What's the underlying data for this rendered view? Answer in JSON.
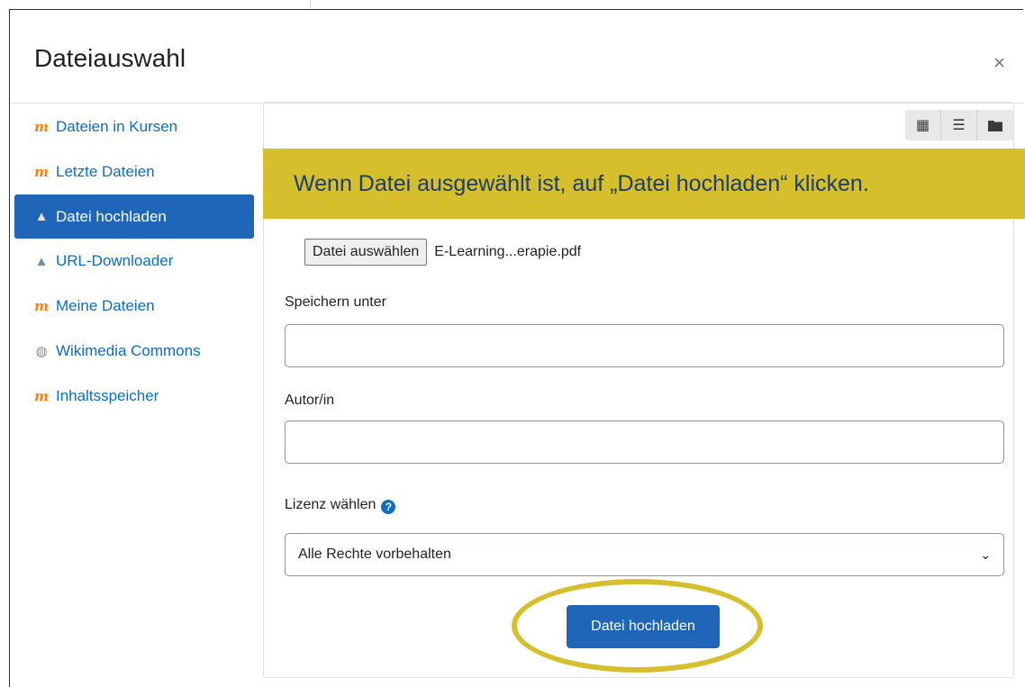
{
  "dialog": {
    "title": "Dateiauswahl",
    "close_label": "×"
  },
  "sidebar": {
    "items": [
      {
        "label": "Dateien in Kursen",
        "icon": "moodle-icon",
        "active": false
      },
      {
        "label": "Letzte Dateien",
        "icon": "moodle-icon",
        "active": false
      },
      {
        "label": "Datei hochladen",
        "icon": "upload-icon",
        "active": true
      },
      {
        "label": "URL-Downloader",
        "icon": "url-downloader-icon",
        "active": false
      },
      {
        "label": "Meine Dateien",
        "icon": "moodle-icon",
        "active": false
      },
      {
        "label": "Wikimedia Commons",
        "icon": "wikimedia-icon",
        "active": false
      },
      {
        "label": "Inhaltsspeicher",
        "icon": "moodle-icon",
        "active": false
      }
    ]
  },
  "toolbar": {
    "views": [
      {
        "name": "icon-view",
        "glyph": "▦"
      },
      {
        "name": "list-view",
        "glyph": "☰"
      },
      {
        "name": "tree-view",
        "glyph": "■"
      }
    ]
  },
  "hint": {
    "text": "Wenn Datei ausgewählt ist, auf „Datei hochladen“ klicken.",
    "color": "#d6bf2c"
  },
  "form": {
    "file_button_label": "Datei auswählen",
    "file_name": "E-Learning...erapie.pdf",
    "save_as_label": "Speichern unter",
    "save_as_value": "",
    "author_label": "Autor/in",
    "author_value": "",
    "license_label": "Lizenz wählen",
    "license_value": "Alle Rechte vorbehalten",
    "submit_label": "Datei hochladen"
  },
  "colors": {
    "primary": "#1f66b8",
    "link": "#0f6cbf",
    "highlight": "#d6bf2c"
  }
}
